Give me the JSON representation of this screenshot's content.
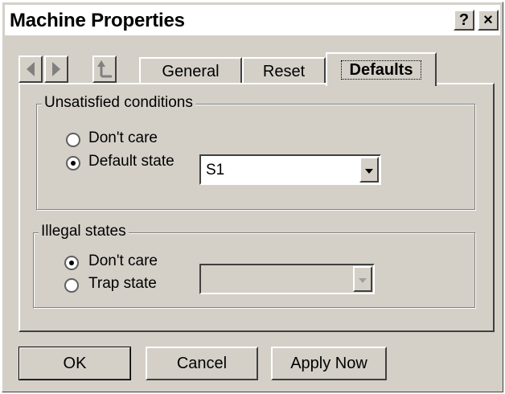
{
  "window": {
    "title": "Machine Properties",
    "help_label": "?",
    "close_label": "×"
  },
  "nav": {
    "back_icon": "left-arrow-icon",
    "forward_icon": "right-arrow-icon",
    "up_icon": "up-level-icon"
  },
  "tabs": [
    {
      "label": "General",
      "active": false
    },
    {
      "label": "Reset",
      "active": false
    },
    {
      "label": "Defaults",
      "active": true
    }
  ],
  "unsatisfied": {
    "legend": "Unsatisfied conditions",
    "options": [
      {
        "label": "Don't care",
        "checked": false
      },
      {
        "label": "Default state",
        "checked": true
      }
    ],
    "default_state_value": "S1"
  },
  "illegal": {
    "legend": "Illegal states",
    "options": [
      {
        "label": "Don't care",
        "checked": true
      },
      {
        "label": "Trap state",
        "checked": false
      }
    ],
    "trap_state_value": ""
  },
  "buttons": {
    "ok": "OK",
    "cancel": "Cancel",
    "apply": "Apply Now"
  }
}
